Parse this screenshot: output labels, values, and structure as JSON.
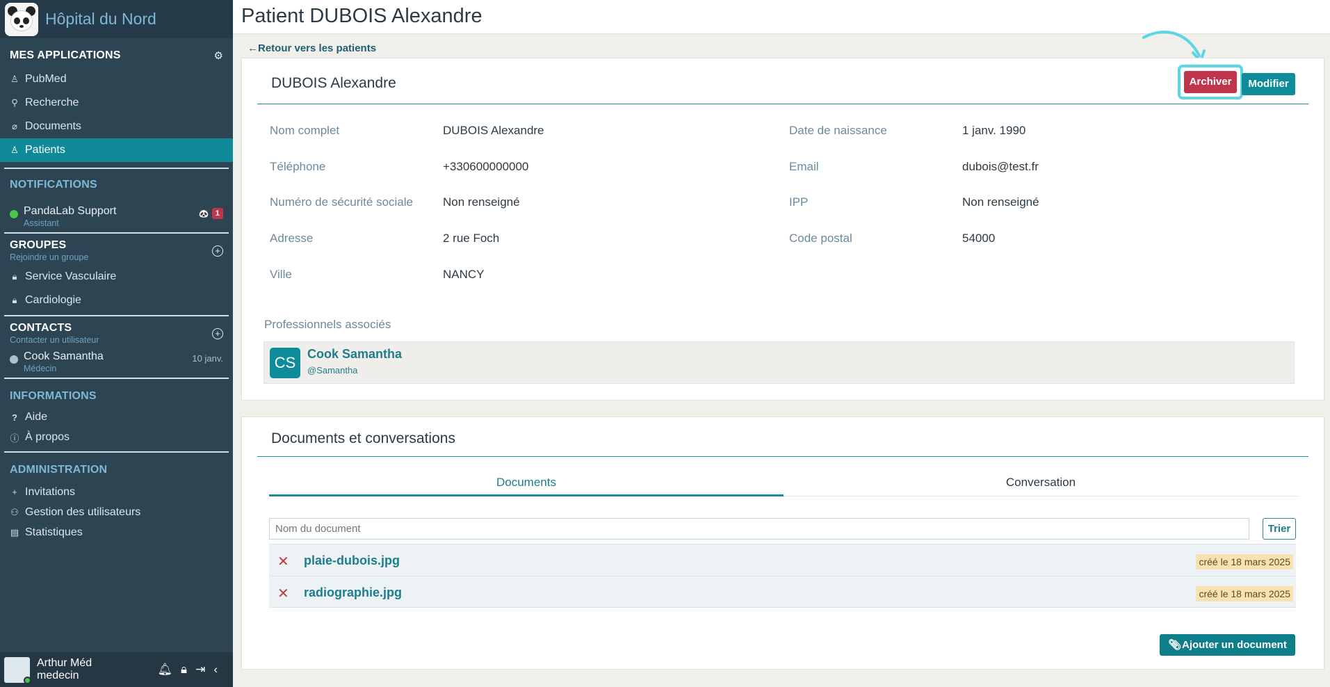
{
  "brand": {
    "title": "Hôpital du Nord"
  },
  "sidebar": {
    "apps_title": "MES APPLICATIONS",
    "apps": [
      {
        "label": "PubMed",
        "icon": "book-icon"
      },
      {
        "label": "Recherche",
        "icon": "search-icon"
      },
      {
        "label": "Documents",
        "icon": "paperclip-icon"
      },
      {
        "label": "Patients",
        "icon": "user-icon"
      }
    ],
    "notifications_title": "NOTIFICATIONS",
    "notification": {
      "name": "PandaLab Support",
      "role": "Assistant",
      "count": "1"
    },
    "groups_title": "GROUPES",
    "groups_sub": "Rejoindre un groupe",
    "groups": [
      {
        "label": "Service Vasculaire"
      },
      {
        "label": "Cardiologie"
      }
    ],
    "contacts_title": "CONTACTS",
    "contacts_sub": "Contacter un utilisateur",
    "contact": {
      "name": "Cook Samantha",
      "role": "Médecin",
      "date": "10 janv."
    },
    "info_title": "INFORMATIONS",
    "info": [
      {
        "label": "Aide",
        "icon": "question-icon"
      },
      {
        "label": "À propos",
        "icon": "info-icon"
      }
    ],
    "admin_title": "ADMINISTRATION",
    "admin": [
      {
        "label": "Invitations",
        "icon": "plus-icon"
      },
      {
        "label": "Gestion des utilisateurs",
        "icon": "users-icon"
      },
      {
        "label": "Statistiques",
        "icon": "chart-icon"
      }
    ],
    "user": {
      "name": "Arthur Méd",
      "role": "medecin"
    }
  },
  "page": {
    "title": "Patient DUBOIS Alexandre",
    "back_label": "Retour vers les patients"
  },
  "patient": {
    "name": "DUBOIS Alexandre",
    "archive_label": "Archiver",
    "modify_label": "Modifier",
    "fields": {
      "fullname_label": "Nom complet",
      "fullname": "DUBOIS Alexandre",
      "birth_label": "Date de naissance",
      "birth": "1 janv. 1990",
      "phone_label": "Téléphone",
      "phone": "+330600000000",
      "email_label": "Email",
      "email": "dubois@test.fr",
      "ssn_label": "Numéro de sécurité sociale",
      "ssn": "Non renseigné",
      "ipp_label": "IPP",
      "ipp": "Non renseigné",
      "address_label": "Adresse",
      "address": "2 rue Foch",
      "postal_label": "Code postal",
      "postal": "54000",
      "city_label": "Ville",
      "city": "NANCY"
    },
    "assoc_title": "Professionnels associés",
    "professional": {
      "initials": "CS",
      "name": "Cook Samantha",
      "handle": "@Samantha"
    }
  },
  "docs": {
    "title": "Documents et conversations",
    "tab_documents": "Documents",
    "tab_conversation": "Conversation",
    "search_placeholder": "Nom du document",
    "sort_label": "Trier",
    "items": [
      {
        "name": "plaie-dubois.jpg",
        "date": "créé le 18 mars 2025"
      },
      {
        "name": "radiographie.jpg",
        "date": "créé le 18 mars 2025"
      }
    ],
    "add_label": "Ajouter un document"
  },
  "colors": {
    "accent": "#0e8c99",
    "danger": "#c0354e",
    "sidebar": "#2d4453",
    "highlight": "#5bd6e6"
  }
}
